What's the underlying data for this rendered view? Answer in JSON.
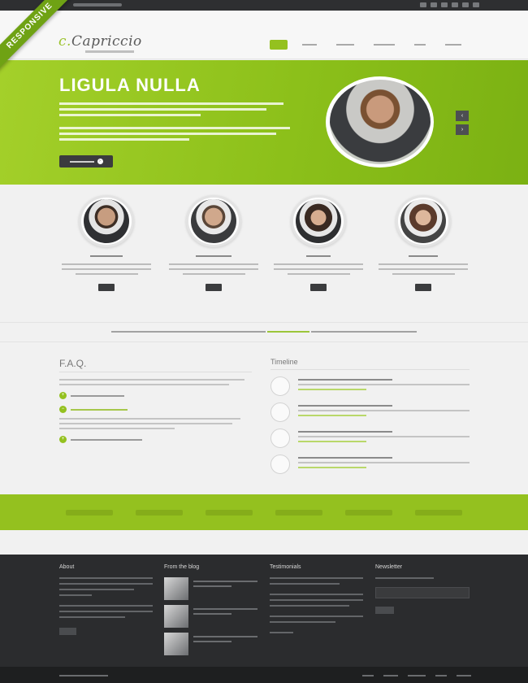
{
  "ribbon": {
    "label": "RESPONSIVE"
  },
  "header": {
    "logo_text": "Capriccio",
    "nav": [
      "",
      "",
      "",
      "",
      "",
      ""
    ]
  },
  "hero": {
    "title": "LIGULA NULLA",
    "button_label": ""
  },
  "team": [
    {
      "name": ""
    },
    {
      "name": ""
    },
    {
      "name": ""
    },
    {
      "name": ""
    }
  ],
  "tagline": {
    "text": "",
    "highlight": ""
  },
  "faq": {
    "title": "F.A.Q."
  },
  "timeline": {
    "title": "Timeline",
    "dates": [
      "",
      "",
      "",
      ""
    ]
  },
  "footer": {
    "about_title": "About",
    "blog_title": "From the blog",
    "testimonials_title": "Testimonials",
    "newsletter_title": "Newsletter"
  },
  "colors": {
    "accent": "#94c11f",
    "dark": "#2b2c2e"
  }
}
